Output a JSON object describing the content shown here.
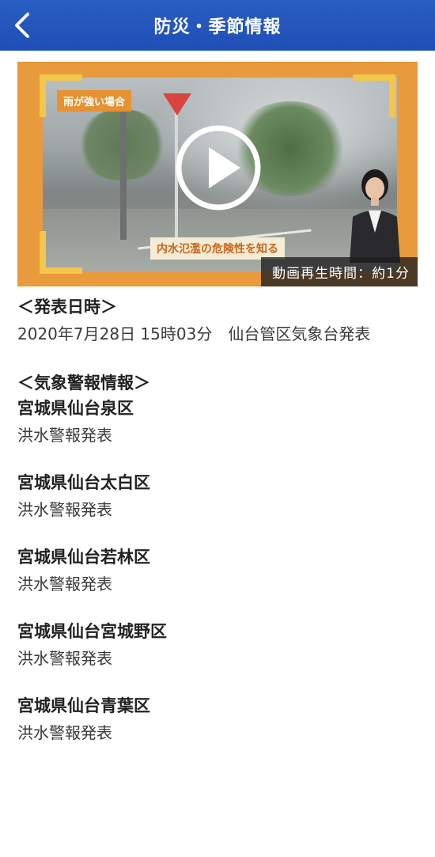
{
  "header": {
    "title": "防災・季節情報"
  },
  "video": {
    "tag_top": "雨が強い場合",
    "tag_bottom": "内水氾濫の危険性を知る",
    "duration": "動画再生時間：約1分"
  },
  "announcement": {
    "heading": "＜発表日時＞",
    "text": "2020年7月28日 15時03分　仙台管区気象台発表"
  },
  "warnings": {
    "heading": "＜気象警報情報＞",
    "areas": [
      {
        "name": "宮城県仙台泉区",
        "status": "洪水警報発表"
      },
      {
        "name": "宮城県仙台太白区",
        "status": "洪水警報発表"
      },
      {
        "name": "宮城県仙台若林区",
        "status": "洪水警報発表"
      },
      {
        "name": "宮城県仙台宮城野区",
        "status": "洪水警報発表"
      },
      {
        "name": "宮城県仙台青葉区",
        "status": "洪水警報発表"
      }
    ]
  }
}
